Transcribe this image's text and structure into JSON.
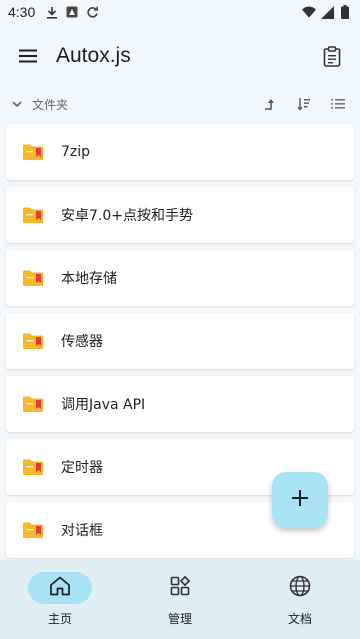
{
  "status_bar": {
    "time": "4:30"
  },
  "app_bar": {
    "title": "Autox.js"
  },
  "path_header": {
    "label": "文件夹"
  },
  "folders": [
    {
      "label": "7zip"
    },
    {
      "label": "安卓7.0+点按和手势"
    },
    {
      "label": "本地存储"
    },
    {
      "label": "传感器"
    },
    {
      "label": "调用Java API"
    },
    {
      "label": "定时器"
    },
    {
      "label": "对话框"
    }
  ],
  "fab": {
    "icon": "plus-icon"
  },
  "bottom_nav": {
    "items": [
      {
        "label": "主页",
        "icon": "home-icon",
        "active": true
      },
      {
        "label": "管理",
        "icon": "grid-icon",
        "active": false
      },
      {
        "label": "文档",
        "icon": "globe-icon",
        "active": false
      }
    ]
  },
  "colors": {
    "accent": "#a8e3f5",
    "nav_background": "#dfeef2",
    "folder": "#f5b829",
    "folder_tab": "#e53935"
  }
}
